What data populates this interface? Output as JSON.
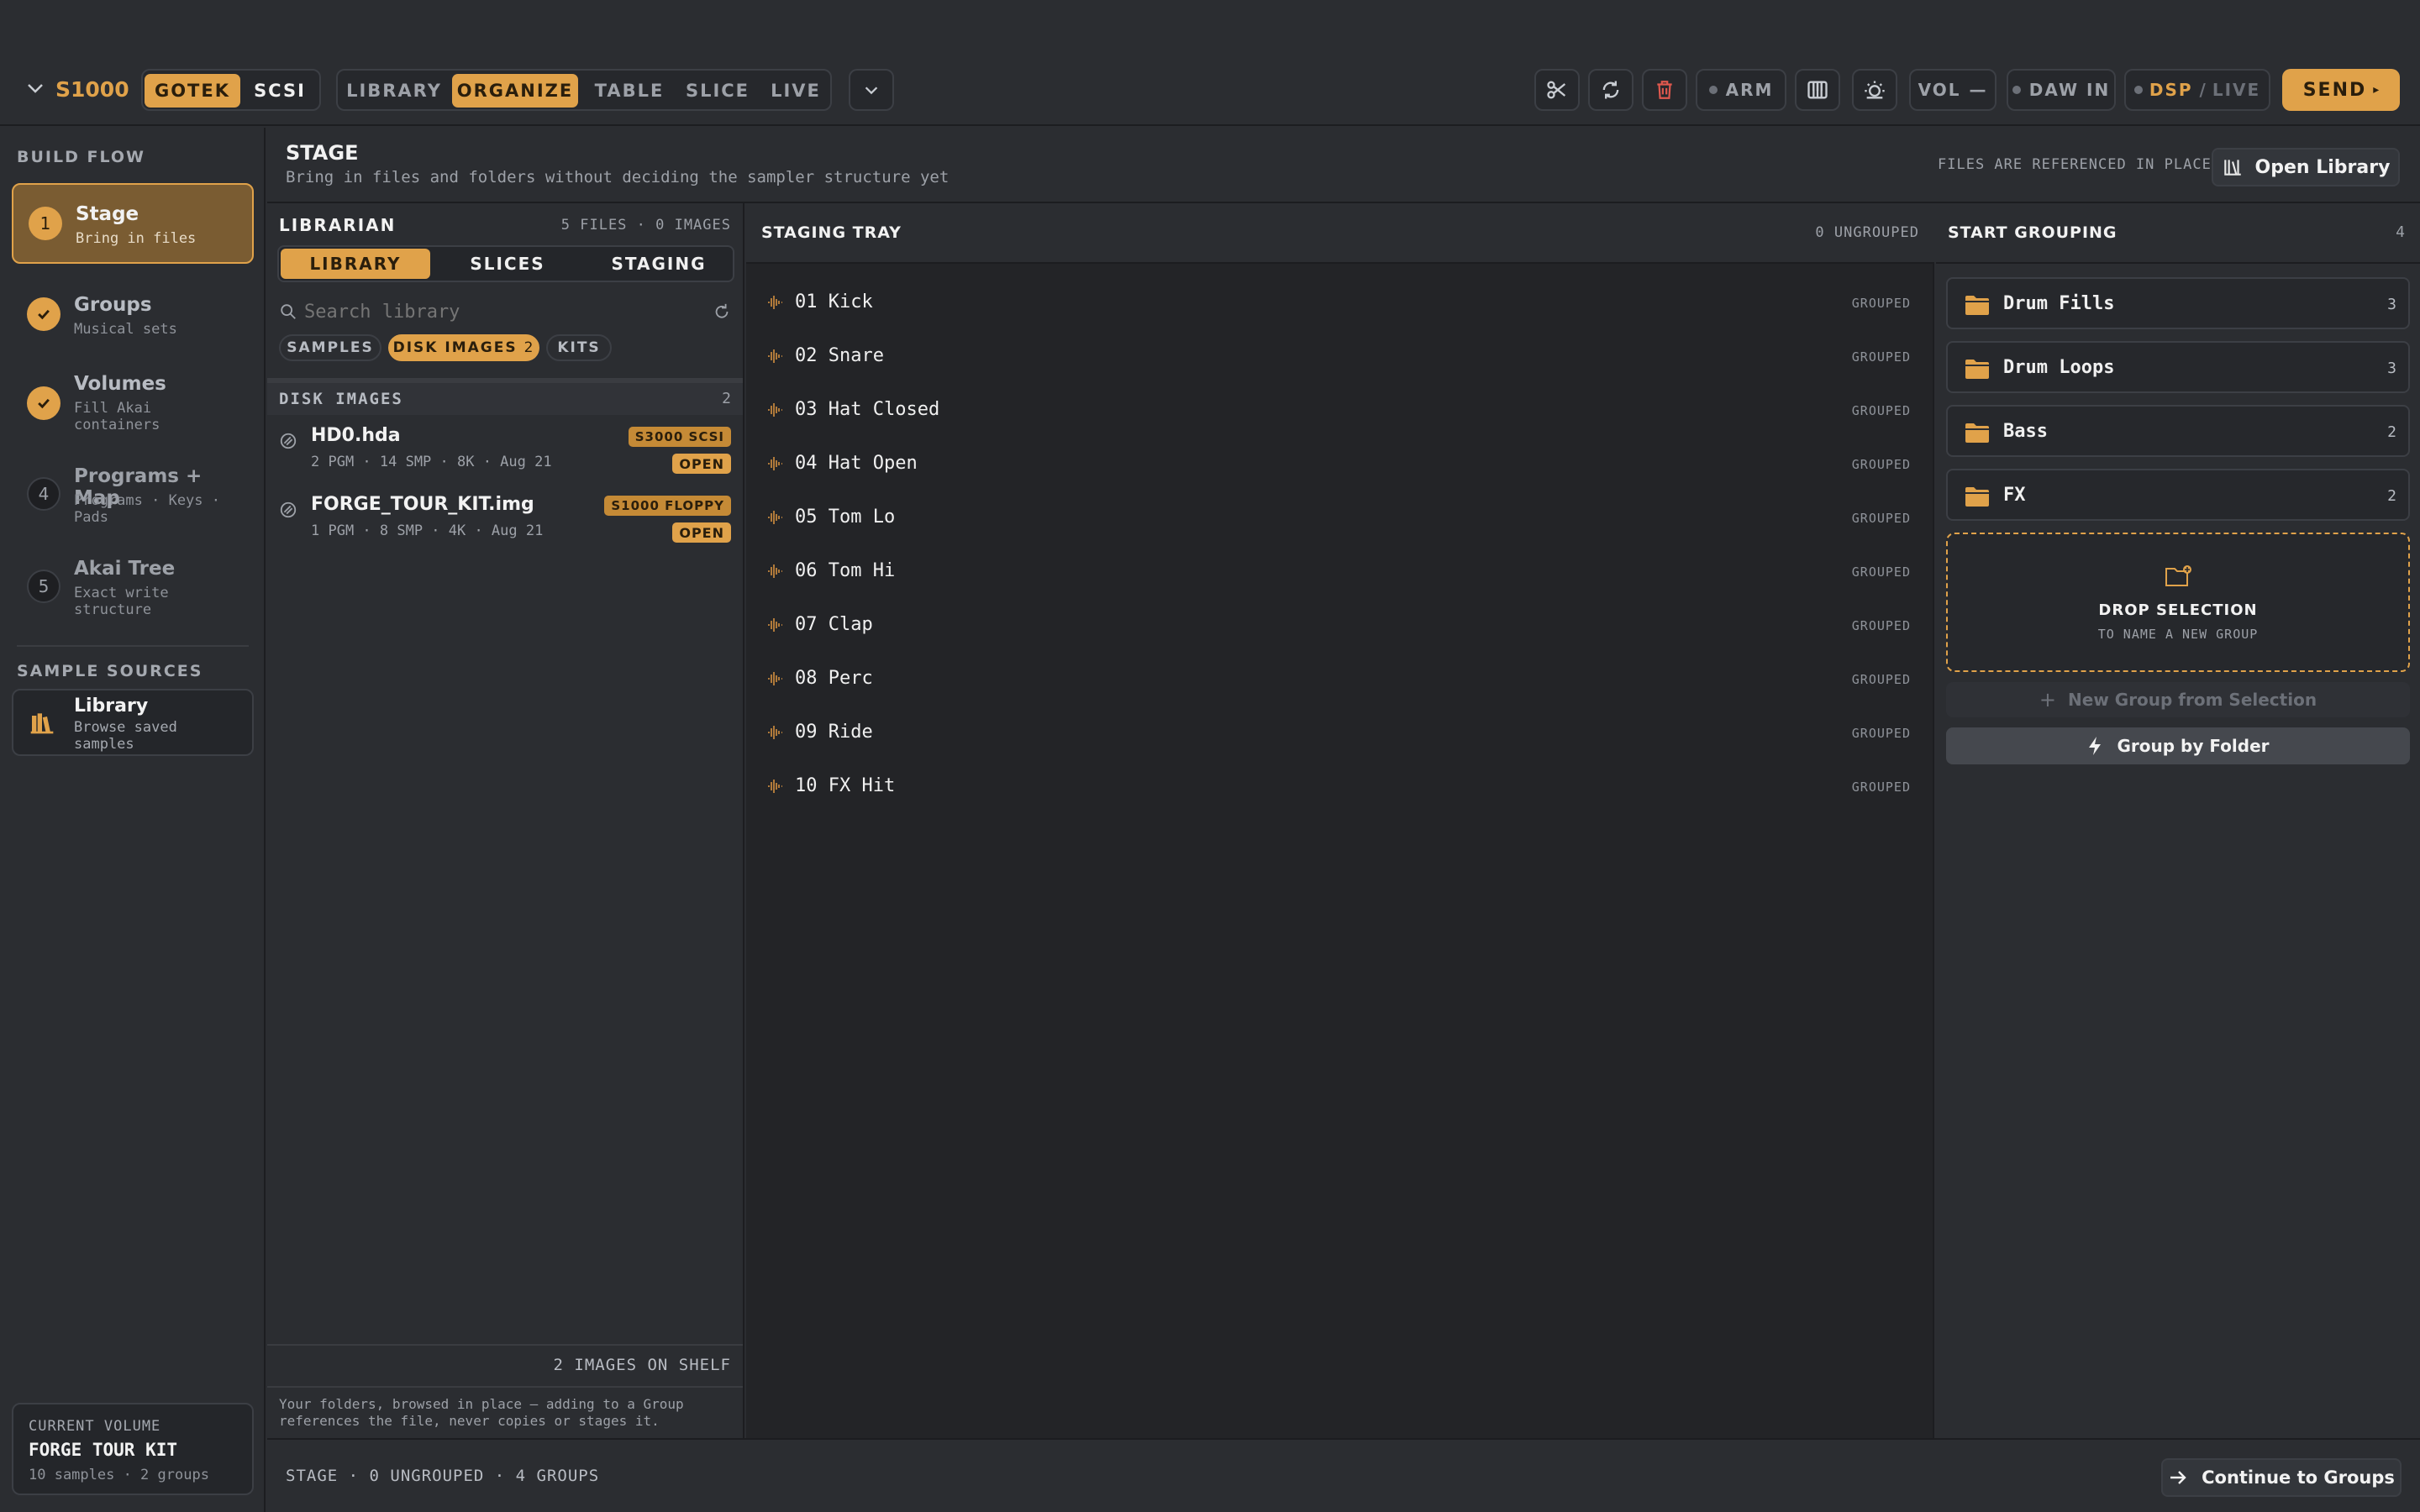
{
  "topbar": {
    "device": "S1000",
    "source_modes": [
      "GOTEK",
      "SCSI"
    ],
    "nav_tabs": [
      "LIBRARY",
      "ORGANIZE",
      "TABLE",
      "SLICE",
      "LIVE"
    ],
    "arm": "ARM",
    "vol_label": "VOL",
    "vol_value": "—",
    "daw_in": "DAW IN",
    "dsp": "DSP",
    "dsp_sep": "/",
    "live": "LIVE",
    "send": "SEND",
    "send_arrow": "▸"
  },
  "sidebar": {
    "build_flow_heading": "BUILD FLOW",
    "steps": [
      {
        "num": "1",
        "title": "Stage",
        "sub": "Bring in files"
      },
      {
        "num": "",
        "title": "Groups",
        "sub": "Musical sets"
      },
      {
        "num": "",
        "title": "Volumes",
        "sub": "Fill Akai containers"
      },
      {
        "num": "4",
        "title": "Programs + Map",
        "sub": "Programs · Keys · Pads"
      },
      {
        "num": "5",
        "title": "Akai Tree",
        "sub": "Exact write structure"
      }
    ],
    "sources_heading": "SAMPLE SOURCES",
    "library": {
      "title": "Library",
      "sub": "Browse saved samples"
    },
    "current_volume": {
      "label": "CURRENT VOLUME",
      "name": "FORGE TOUR KIT",
      "meta": "10 samples · 2 groups"
    }
  },
  "stage": {
    "title": "STAGE",
    "subtitle": "Bring in files and folders without deciding the sampler structure yet",
    "ref_note": "FILES ARE REFERENCED IN PLACE",
    "open_library": "Open Library"
  },
  "librarian": {
    "title": "LIBRARIAN",
    "counts": "5 FILES · 0 IMAGES",
    "tabs": [
      "LIBRARY",
      "SLICES",
      "STAGING"
    ],
    "search_placeholder": "Search library",
    "filters": [
      {
        "label": "SAMPLES",
        "count": ""
      },
      {
        "label": "DISK IMAGES",
        "count": "2"
      },
      {
        "label": "KITS",
        "count": ""
      }
    ],
    "section_title": "DISK IMAGES",
    "section_count": "2",
    "disks": [
      {
        "name": "HD0.hda",
        "meta": "2 PGM · 14 SMP · 8K · Aug 21",
        "tag": "S3000 SCSI",
        "action": "OPEN"
      },
      {
        "name": "FORGE_TOUR_KIT.img",
        "meta": "1 PGM · 8 SMP · 4K · Aug 21",
        "tag": "S1000 FLOPPY",
        "action": "OPEN"
      }
    ],
    "shelf": "2 IMAGES ON SHELF",
    "note_line1": "Your folders, browsed in place — adding to a Group",
    "note_line2": "references the file, never copies or stages it."
  },
  "tray": {
    "title": "STAGING TRAY",
    "count": "0 UNGROUPED",
    "items": [
      {
        "name": "01 Kick",
        "status": "GROUPED"
      },
      {
        "name": "02 Snare",
        "status": "GROUPED"
      },
      {
        "name": "03 Hat Closed",
        "status": "GROUPED"
      },
      {
        "name": "04 Hat Open",
        "status": "GROUPED"
      },
      {
        "name": "05 Tom Lo",
        "status": "GROUPED"
      },
      {
        "name": "06 Tom Hi",
        "status": "GROUPED"
      },
      {
        "name": "07 Clap",
        "status": "GROUPED"
      },
      {
        "name": "08 Perc",
        "status": "GROUPED"
      },
      {
        "name": "09 Ride",
        "status": "GROUPED"
      },
      {
        "name": "10 FX Hit",
        "status": "GROUPED"
      }
    ]
  },
  "grouping": {
    "title": "START GROUPING",
    "count": "4",
    "groups": [
      {
        "name": "Drum Fills",
        "count": "3"
      },
      {
        "name": "Drum Loops",
        "count": "3"
      },
      {
        "name": "Bass",
        "count": "2"
      },
      {
        "name": "FX",
        "count": "2"
      }
    ],
    "drop_title": "DROP SELECTION",
    "drop_sub": "TO NAME A NEW GROUP",
    "new_group": "New Group from Selection",
    "group_by_folder": "Group by Folder"
  },
  "footer": {
    "status": "STAGE · 0 UNGROUPED · 4 GROUPS",
    "continue": "Continue to Groups"
  },
  "colors": {
    "accent": "#e0a24a",
    "background": "#2b2d31",
    "tray_background": "#232427",
    "danger": "#e0584e"
  }
}
